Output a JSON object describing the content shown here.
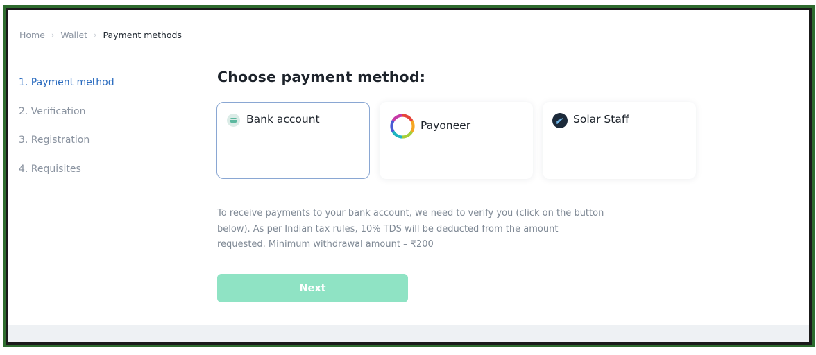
{
  "breadcrumb": {
    "home": "Home",
    "wallet": "Wallet",
    "current": "Payment methods"
  },
  "steps": [
    {
      "label": "1. Payment method",
      "active": true
    },
    {
      "label": "2. Verification",
      "active": false
    },
    {
      "label": "3. Registration",
      "active": false
    },
    {
      "label": "4. Requisites",
      "active": false
    }
  ],
  "main": {
    "title": "Choose payment method:",
    "methods": [
      {
        "label": "Bank account",
        "icon": "bank-card-icon",
        "selected": true
      },
      {
        "label": "Payoneer",
        "icon": "payoneer-ring-icon",
        "selected": false
      },
      {
        "label": "Solar Staff",
        "icon": "solar-staff-icon",
        "selected": false
      }
    ],
    "description": "To receive payments to your bank account, we need to verify you (click on the button below). As per Indian tax rules, 10% TDS will be deducted from the amount requested. Minimum withdrawal amount – ₹200",
    "next_label": "Next"
  },
  "colors": {
    "frame": "#2e6b2e",
    "accent": "#2a6bbf",
    "button": "#8fe3c4",
    "selected_border": "#8aa7d3"
  }
}
